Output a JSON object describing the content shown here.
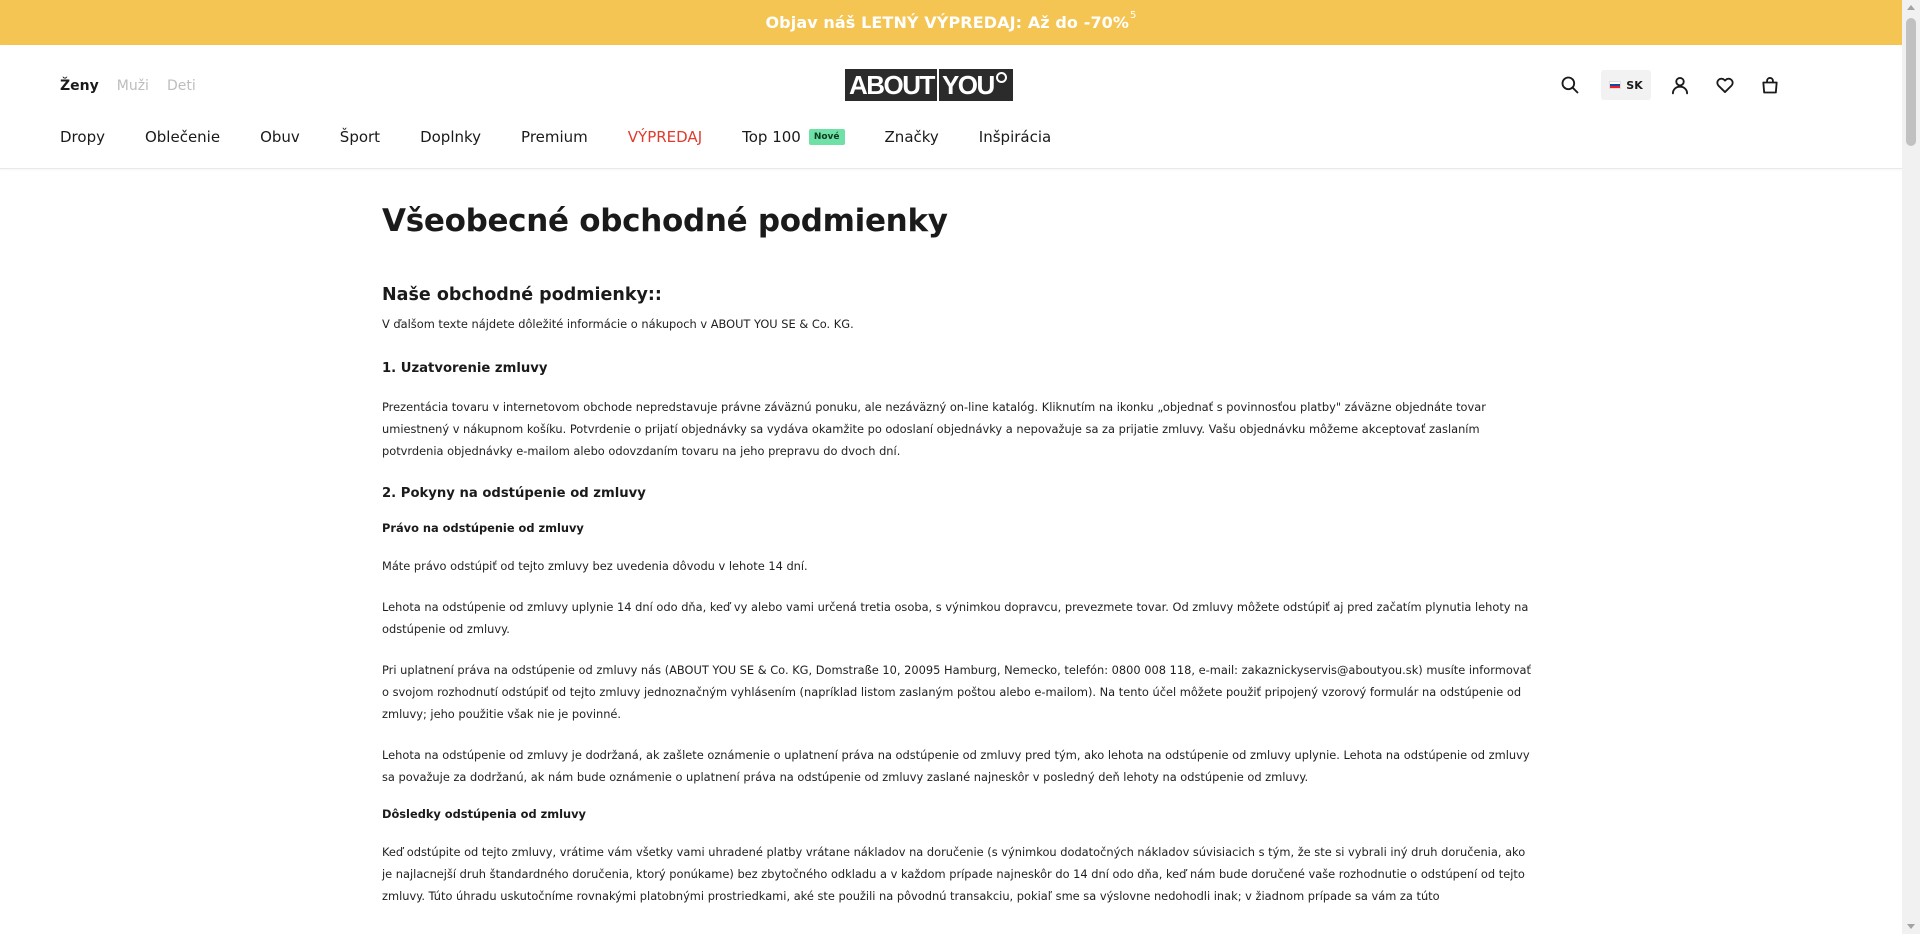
{
  "promo": {
    "text": "Objav náš LETNÝ VÝPREDAJ: Až do -70%",
    "footnote": "5"
  },
  "header": {
    "gender_tabs": [
      "Ženy",
      "Muži",
      "Deti"
    ],
    "logo": "ABOUT YOU",
    "language": "SK",
    "icons": [
      "search-icon",
      "flag-icon",
      "user-icon",
      "heart-icon",
      "bag-icon"
    ]
  },
  "nav": {
    "items": [
      "Dropy",
      "Oblečenie",
      "Obuv",
      "Šport",
      "Doplnky",
      "Premium",
      "VÝPREDAJ",
      "Top 100",
      "Značky",
      "Inšpirácia"
    ],
    "new_badge": "Nové"
  },
  "colors": {
    "promo_bg": "#f5c553",
    "sale": "#e03b2f",
    "badge_bg": "#6fe1a6"
  },
  "content": {
    "title": "Všeobecné obchodné podmienky",
    "intro_heading": "Naše obchodné podmienky::",
    "intro_text": "V ďalšom texte nájdete dôležité informácie o nákupoch v ABOUT YOU SE & Co. KG.",
    "s1_heading": "1. Uzatvorenie zmluvy",
    "s1_text": "Prezentácia tovaru v internetovom obchode nepredstavuje právne záväznú ponuku, ale nezáväzný on-line katalóg. Kliknutím na ikonku „objednať s povinnosťou platby\" záväzne objednáte tovar umiestnený v nákupnom košíku. Potvrdenie o prijatí objednávky sa vydáva okamžite po odoslaní objednávky a nepovažuje sa za prijatie zmluvy. Vašu objednávku môžeme akceptovať zaslaním potvrdenia objednávky e-mailom alebo odovzdaním tovaru na jeho prepravu do dvoch dní.",
    "s2_heading": "2. Pokyny na odstúpenie od zmluvy",
    "s2_sub1": "Právo na odstúpenie od zmluvy",
    "s2_p1": "Máte právo odstúpiť od tejto zmluvy bez uvedenia dôvodu v lehote 14 dní.",
    "s2_p2": "Lehota na odstúpenie od zmluvy uplynie 14 dní odo dňa, keď vy alebo vami určená tretia osoba, s výnimkou dopravcu, prevezmete tovar. Od zmluvy môžete odstúpiť aj pred začatím plynutia lehoty na odstúpenie od zmluvy.",
    "s2_p3": "Pri uplatnení práva na odstúpenie od zmluvy nás (ABOUT YOU SE & Co. KG, Domstraße 10, 20095 Hamburg, Nemecko, telefón: 0800 008 118, e-mail: zakaznickyservis@aboutyou.sk) musíte informovať o svojom rozhodnutí odstúpiť od tejto zmluvy jednoznačným vyhlásením (napríklad listom zaslaným poštou alebo e-mailom). Na tento účel môžete použiť pripojený vzorový formulár na odstúpenie od zmluvy; jeho použitie však nie je povinné.",
    "s2_p4": "Lehota na odstúpenie od zmluvy je dodržaná, ak zašlete oznámenie o uplatnení práva na odstúpenie od zmluvy pred tým, ako lehota na odstúpenie od zmluvy uplynie. Lehota na odstúpenie od zmluvy sa považuje za dodržanú, ak nám bude oznámenie o uplatnení práva na odstúpenie od zmluvy zaslané najneskôr v posledný deň lehoty na odstúpenie od zmluvy.",
    "s2_sub2": "Dôsledky odstúpenia od zmluvy",
    "s2_p5": "Keď odstúpite od tejto zmluvy, vrátime vám všetky vami uhradené platby vrátane nákladov na doručenie (s výnimkou dodatočných nákladov súvisiacich s tým, že ste si vybrali iný druh doručenia, ako je najlacnejší druh štandardného doručenia, ktorý ponúkame) bez zbytočného odkladu a v každom prípade najneskôr do 14 dní odo dňa, keď nám bude doručené vaše rozhodnutie o odstúpení od tejto zmluvy. Túto úhradu uskutočníme rovnakými platobnými prostriedkami, aké ste použili na pôvodnú transakciu, pokiaľ sme sa výslovne nedohodli inak; v žiadnom prípade sa vám za túto"
  }
}
